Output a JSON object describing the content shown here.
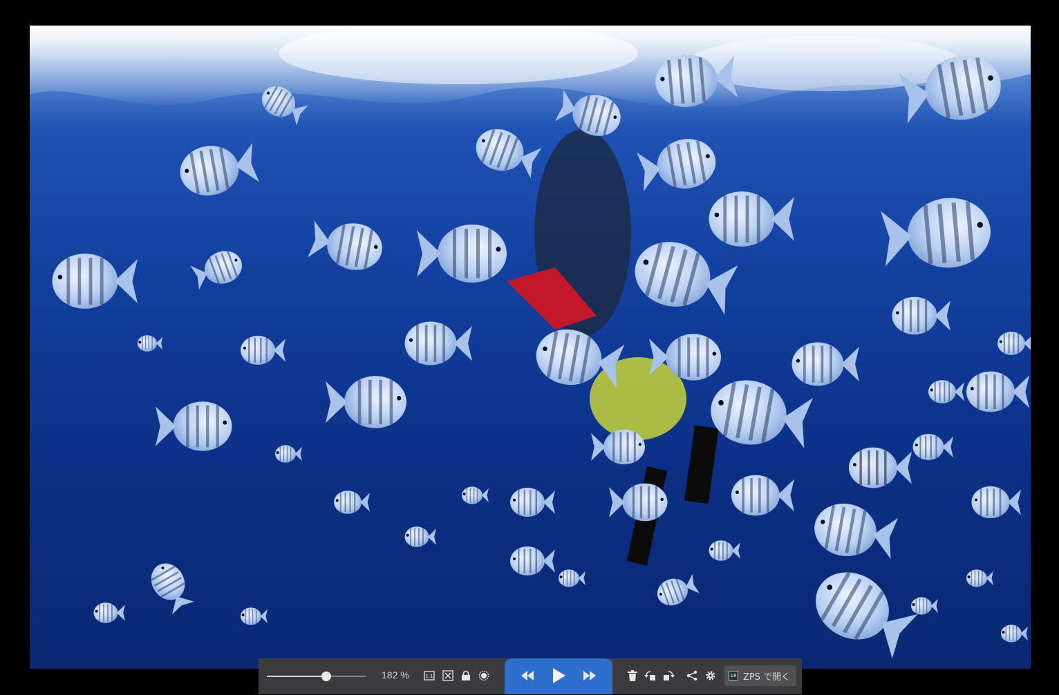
{
  "image": {
    "description_icon": "photo-underwater-fish"
  },
  "toolbar": {
    "zoom_slider_level": 0.6,
    "zoom_text": "182 %",
    "actual_size_icon": "one-to-one-icon",
    "fit_icon": "fit-screen-icon",
    "lock_icon": "lock-icon",
    "brightness_icon": "sun-icon",
    "prev_icon": "rewind-icon",
    "play_icon": "play-icon",
    "next_icon": "fast-forward-icon",
    "delete_icon": "trash-icon",
    "rotate_left_icon": "rotate-left-icon",
    "rotate_right_icon": "rotate-right-icon",
    "share_icon": "share-icon",
    "settings_icon": "gear-icon",
    "open_zps_label": "ZPS で開く",
    "open_zps_logo": "18",
    "accent_color": "#2f6fcc"
  }
}
